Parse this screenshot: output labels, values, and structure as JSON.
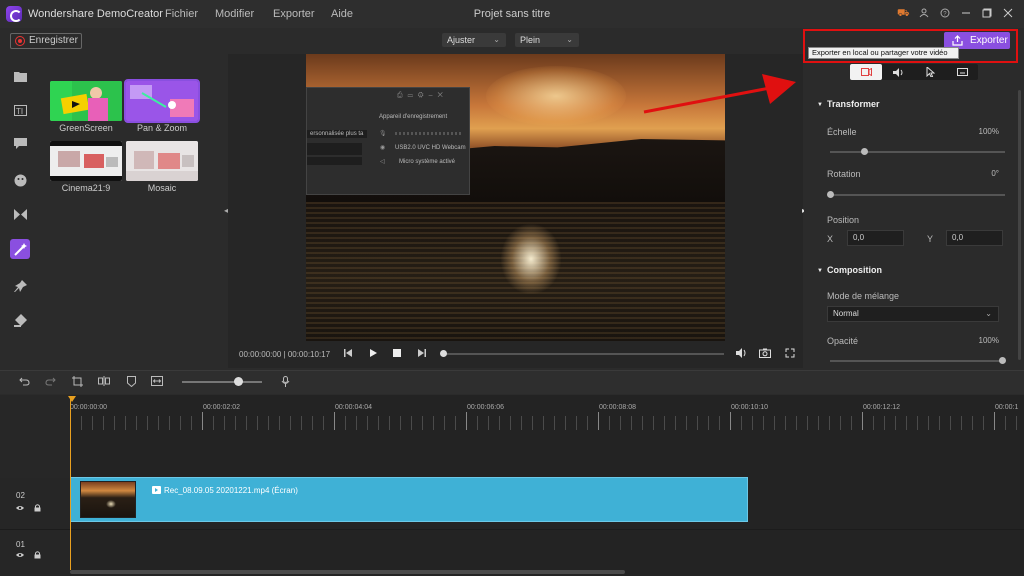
{
  "app": {
    "name": "Wondershare DemoCreator",
    "document_title": "Projet sans titre",
    "menu": [
      "Fichier",
      "Modifier",
      "Exporter",
      "Aide"
    ]
  },
  "toolbar": {
    "record_label": "Enregistrer",
    "fit_select": "Ajuster",
    "quality_select": "Plein"
  },
  "effects": {
    "items": [
      {
        "label": "GreenScreen"
      },
      {
        "label": "Pan & Zoom"
      },
      {
        "label": "Cinema21:9"
      },
      {
        "label": "Mosaic"
      }
    ]
  },
  "overlay": {
    "section_title": "Appareil d'enregistrement",
    "dropdown_text": "ersonnalisée plus ta",
    "webcam": "USB2.0 UVC HD Webcam",
    "mic": "Micro système activé"
  },
  "player": {
    "current_time": "00:00:00:00",
    "total_time": "00:00:10:17",
    "separator": "|"
  },
  "export": {
    "button_label": "Exporter",
    "tooltip": "Exporter en local ou partager votre vidéo"
  },
  "properties": {
    "transform_title": "Transformer",
    "scale_label": "Échelle",
    "scale_value": "100%",
    "rotation_label": "Rotation",
    "rotation_value": "0°",
    "position_label": "Position",
    "x_label": "X",
    "x_value": "0,0",
    "y_label": "Y",
    "y_value": "0,0",
    "composition_title": "Composition",
    "blend_label": "Mode de mélange",
    "blend_value": "Normal",
    "opacity_label": "Opacité",
    "opacity_value": "100%"
  },
  "sliders": {
    "scale_fraction": 0.2,
    "rotation_fraction": 0.0,
    "opacity_fraction": 1.0,
    "zoom_fraction": 0.7
  },
  "timeline": {
    "ruler": [
      "00:00:00:00",
      "00:00:02:02",
      "00:00:04:04",
      "00:00:06:06",
      "00:00:08:08",
      "00:00:10:10",
      "00:00:12:12",
      "00:00:1"
    ],
    "tracks": [
      {
        "number": "02",
        "clip": "Rec_08.09.05 20201221.mp4 (Écran)"
      },
      {
        "number": "01",
        "clip": ""
      }
    ]
  },
  "colors": {
    "accent": "#8a4fe0",
    "clip": "#3fb1d6",
    "playhead": "#e8a020",
    "highlight": "#e01010"
  }
}
